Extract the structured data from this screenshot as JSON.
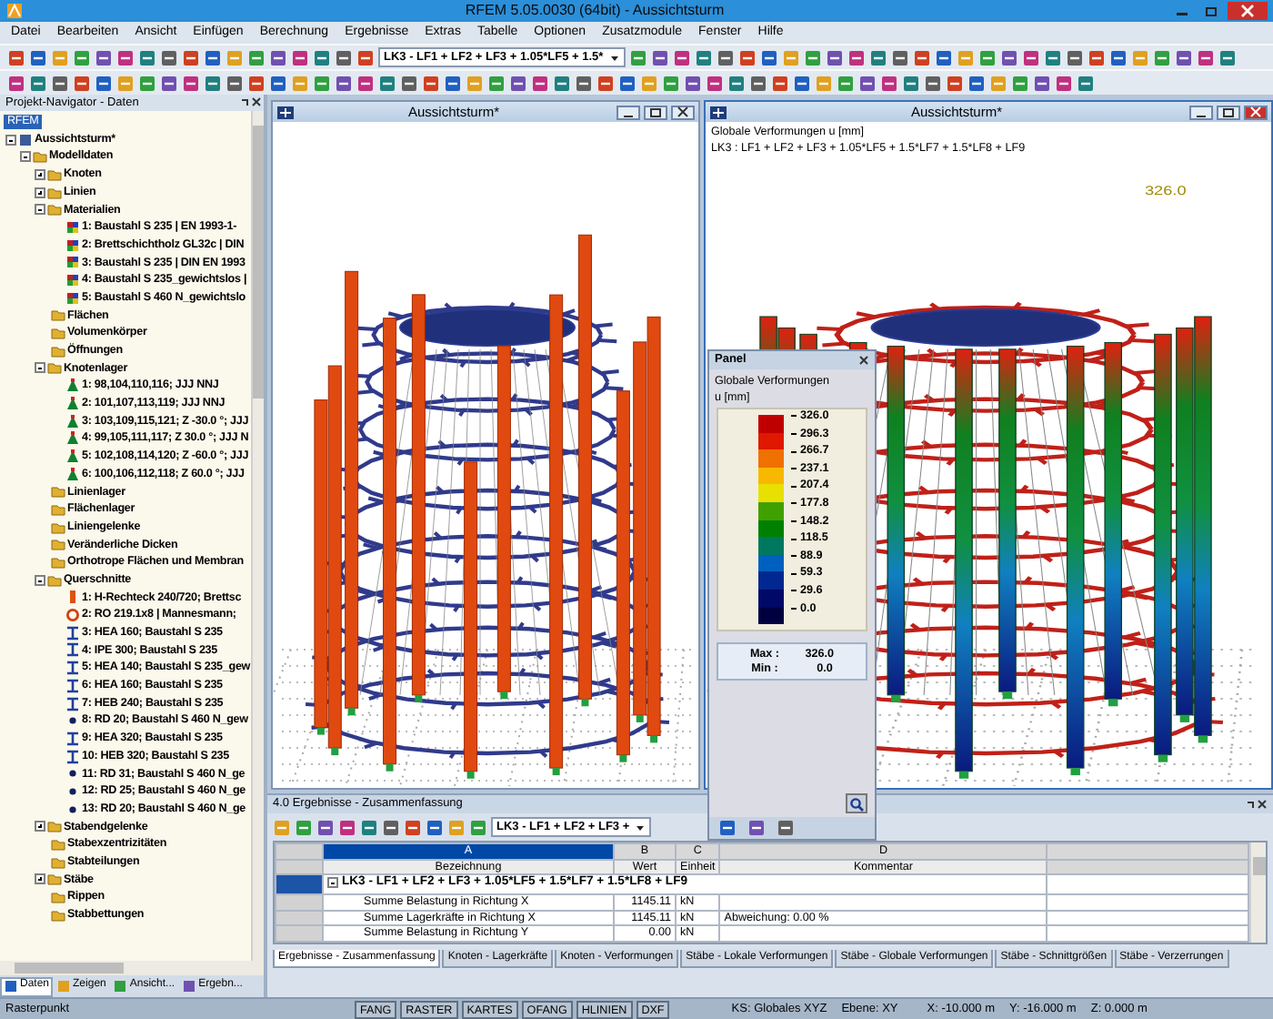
{
  "window": {
    "title": "RFEM 5.05.0030 (64bit) - Aussichtsturm"
  },
  "menu": [
    "Datei",
    "Bearbeiten",
    "Ansicht",
    "Einfügen",
    "Berechnung",
    "Ergebnisse",
    "Extras",
    "Tabelle",
    "Optionen",
    "Zusatzmodule",
    "Fenster",
    "Hilfe"
  ],
  "toolbar": {
    "loadcase": "LK3 - LF1 + LF2 + LF3 + 1.05*LF5 + 1.5*"
  },
  "navigator": {
    "title": "Projekt-Navigator - Daten",
    "badge": "RFEM",
    "tree": [
      {
        "label": "Aussichtsturm*",
        "kind": "model",
        "expanded": true,
        "children": [
          {
            "label": "Modelldaten",
            "kind": "folder",
            "expanded": true,
            "children": [
              {
                "label": "Knoten",
                "kind": "folder",
                "expanded": false
              },
              {
                "label": "Linien",
                "kind": "folder",
                "expanded": false
              },
              {
                "label": "Materialien",
                "kind": "folder",
                "expanded": true,
                "children": [
                  {
                    "label": "1: Baustahl S 235 | EN 1993-1-",
                    "kind": "material"
                  },
                  {
                    "label": "2: Brettschichtholz GL32c | DIN",
                    "kind": "material"
                  },
                  {
                    "label": "3: Baustahl S 235 | DIN EN 1993",
                    "kind": "material"
                  },
                  {
                    "label": "4: Baustahl S 235_gewichtslos |",
                    "kind": "material"
                  },
                  {
                    "label": "5: Baustahl S 460 N_gewichtslo",
                    "kind": "material"
                  }
                ]
              },
              {
                "label": "Flächen",
                "kind": "folder"
              },
              {
                "label": "Volumenkörper",
                "kind": "folder"
              },
              {
                "label": "Öffnungen",
                "kind": "folder"
              },
              {
                "label": "Knotenlager",
                "kind": "folder",
                "expanded": true,
                "children": [
                  {
                    "label": "1: 98,104,110,116; JJJ NNJ",
                    "kind": "support"
                  },
                  {
                    "label": "2: 101,107,113,119; JJJ NNJ",
                    "kind": "support"
                  },
                  {
                    "label": "3: 103,109,115,121; Z -30.0 °; JJJ",
                    "kind": "support"
                  },
                  {
                    "label": "4: 99,105,111,117; Z 30.0 °; JJJ N",
                    "kind": "support"
                  },
                  {
                    "label": "5: 102,108,114,120; Z -60.0 °; JJJ",
                    "kind": "support"
                  },
                  {
                    "label": "6: 100,106,112,118; Z 60.0 °; JJJ",
                    "kind": "support"
                  }
                ]
              },
              {
                "label": "Linienlager",
                "kind": "folder"
              },
              {
                "label": "Flächenlager",
                "kind": "folder"
              },
              {
                "label": "Liniengelenke",
                "kind": "folder"
              },
              {
                "label": "Veränderliche Dicken",
                "kind": "folder"
              },
              {
                "label": "Orthotrope Flächen und Membran",
                "kind": "folder"
              },
              {
                "label": "Querschnitte",
                "kind": "folder",
                "expanded": true,
                "children": [
                  {
                    "label": "1: H-Rechteck 240/720; Brettsc",
                    "kind": "sec-rect"
                  },
                  {
                    "label": "2: RO 219.1x8 | Mannesmann;",
                    "kind": "sec-pipe"
                  },
                  {
                    "label": "3: HEA 160; Baustahl S 235",
                    "kind": "sec-i"
                  },
                  {
                    "label": "4: IPE 300; Baustahl S 235",
                    "kind": "sec-i"
                  },
                  {
                    "label": "5: HEA 140; Baustahl S 235_gew",
                    "kind": "sec-i"
                  },
                  {
                    "label": "6: HEA 160; Baustahl S 235",
                    "kind": "sec-i"
                  },
                  {
                    "label": "7: HEB 240; Baustahl S 235",
                    "kind": "sec-i"
                  },
                  {
                    "label": "8: RD 20; Baustahl S 460 N_gew",
                    "kind": "sec-dot"
                  },
                  {
                    "label": "9: HEA 320; Baustahl S 235",
                    "kind": "sec-i"
                  },
                  {
                    "label": "10: HEB 320; Baustahl S 235",
                    "kind": "sec-i"
                  },
                  {
                    "label": "11: RD 31; Baustahl S 460 N_ge",
                    "kind": "sec-dot"
                  },
                  {
                    "label": "12: RD 25; Baustahl S 460 N_ge",
                    "kind": "sec-dot"
                  },
                  {
                    "label": "13: RD 20; Baustahl S 460 N_ge",
                    "kind": "sec-dot"
                  }
                ]
              },
              {
                "label": "Stabendgelenke",
                "kind": "folder",
                "expanded": false
              },
              {
                "label": "Stabexzentrizitäten",
                "kind": "folder"
              },
              {
                "label": "Stabteilungen",
                "kind": "folder"
              },
              {
                "label": "Stäbe",
                "kind": "folder",
                "expanded": false
              },
              {
                "label": "Rippen",
                "kind": "folder"
              },
              {
                "label": "Stabbettungen",
                "kind": "folder"
              }
            ]
          }
        ]
      }
    ],
    "tabs": [
      {
        "label": "Daten",
        "selected": true
      },
      {
        "label": "Zeigen",
        "selected": false
      },
      {
        "label": "Ansicht...",
        "selected": false
      },
      {
        "label": "Ergebn...",
        "selected": false
      }
    ]
  },
  "viewports": [
    {
      "title": "Aussichtsturm*",
      "kind": "model",
      "active": false
    },
    {
      "title": "Aussichtsturm*",
      "kind": "results",
      "active": true,
      "caption": [
        "Globale Verformungen u [mm]",
        "LK3 : LF1 + LF2 + LF3 + 1.05*LF5 + 1.5*LF7 + 1.5*LF8 + LF9"
      ],
      "max_label": "326.0"
    }
  ],
  "panel": {
    "title": "Panel",
    "heading": "Globale Verformungen",
    "unit": "u [mm]",
    "legend": [
      {
        "value": "326.0",
        "color": "#c00000"
      },
      {
        "value": "296.3",
        "color": "#e01800"
      },
      {
        "value": "266.7",
        "color": "#f07000"
      },
      {
        "value": "237.1",
        "color": "#f8b800"
      },
      {
        "value": "207.4",
        "color": "#e8e000"
      },
      {
        "value": "177.8",
        "color": "#40a000"
      },
      {
        "value": "148.2",
        "color": "#008000"
      },
      {
        "value": "118.5",
        "color": "#007860"
      },
      {
        "value": "88.9",
        "color": "#0060c0"
      },
      {
        "value": "59.3",
        "color": "#002890"
      },
      {
        "value": "29.6",
        "color": "#000868"
      },
      {
        "value": "0.0",
        "color": "#000040"
      }
    ],
    "stats": [
      {
        "label": "Max :",
        "value": "326.0"
      },
      {
        "label": "Min :",
        "value": "0.0"
      }
    ]
  },
  "results": {
    "title": "4.0 Ergebnisse - Zusammenfassung",
    "loadcase": "LK3 - LF1 + LF2 + LF3 +",
    "columns": [
      {
        "letter": "A",
        "header": "Bezeichnung",
        "selected": true
      },
      {
        "letter": "B",
        "header": "Wert",
        "selected": false
      },
      {
        "letter": "C",
        "header": "Einheit",
        "selected": false
      },
      {
        "letter": "D",
        "header": "Kommentar",
        "selected": false
      }
    ],
    "group": {
      "label": "LK3 - LF1 + LF2 + LF3 + 1.05*LF5 + 1.5*LF7 + 1.5*LF8 + LF9",
      "expanded": true
    },
    "rows": [
      {
        "cells": [
          "Summe Belastung in Richtung X",
          "1145.11",
          "kN"
        ]
      },
      {
        "cells": [
          "Summe Lagerkräfte in Richtung X",
          "1145.11",
          "kN",
          "Abweichung:  0.00 %"
        ]
      },
      {
        "cells": [
          "Summe Belastung in Richtung Y",
          "0.00",
          "kN"
        ]
      }
    ],
    "tabs": [
      {
        "label": "Ergebnisse - Zusammenfassung",
        "selected": true
      },
      {
        "label": "Knoten - Lagerkräfte",
        "selected": false
      },
      {
        "label": "Knoten - Verformungen",
        "selected": false
      },
      {
        "label": "Stäbe - Lokale Verformungen",
        "selected": false
      },
      {
        "label": "Stäbe - Globale Verformungen",
        "selected": false
      },
      {
        "label": "Stäbe - Schnittgrößen",
        "selected": false
      },
      {
        "label": "Stäbe - Verzerrungen",
        "selected": false
      }
    ]
  },
  "status_bar": {
    "label": "Rasterpunkt",
    "toggles": [
      "FANG",
      "RASTER",
      "KARTES",
      "OFANG",
      "HLINIEN",
      "DXF"
    ],
    "info": [
      "KS: Globales XYZ",
      "Ebene: XY",
      "X: -10.000 m",
      "Y: -16.000 m",
      "Z: 0.000 m"
    ]
  }
}
